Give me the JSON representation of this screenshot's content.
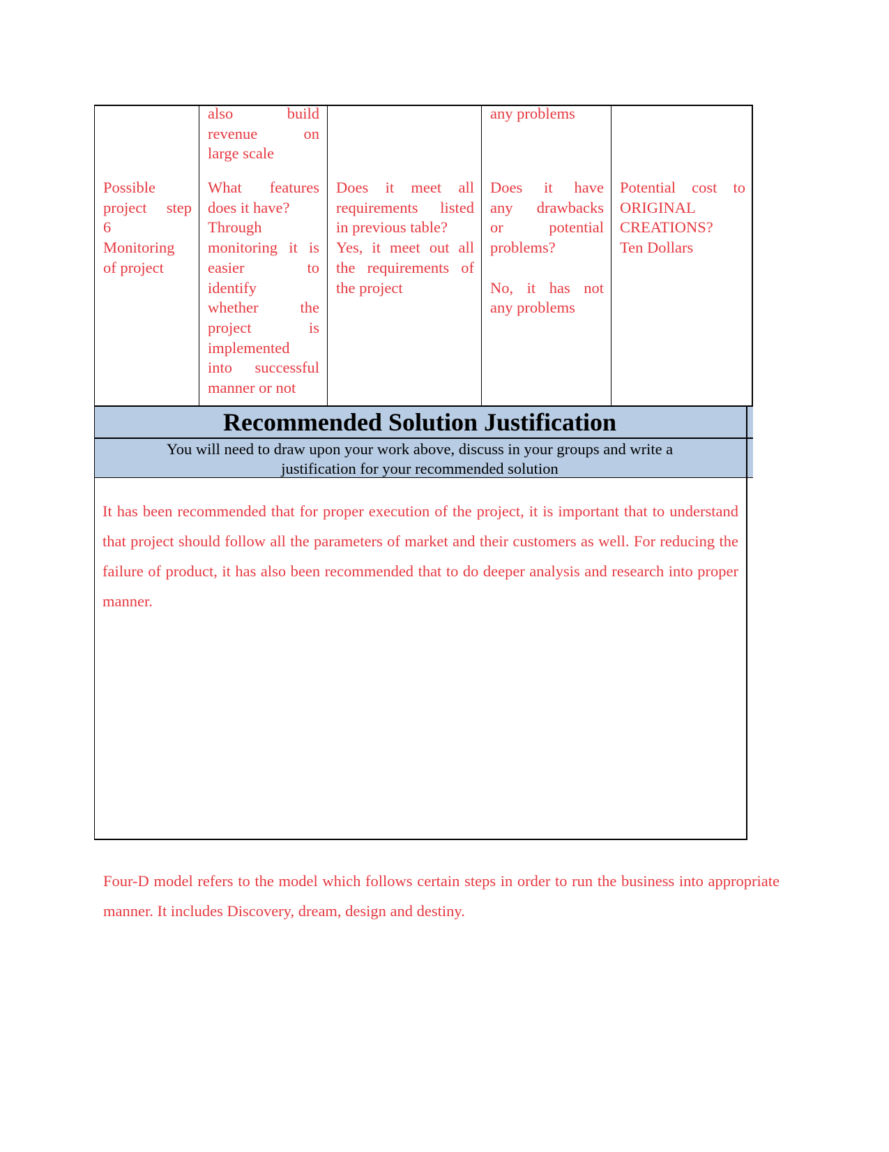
{
  "table": {
    "columns": [
      {
        "name": "project-step",
        "top_text": "",
        "lines": [
          "Possible",
          "project step",
          "6",
          "Monitoring",
          "of project"
        ]
      },
      {
        "name": "features",
        "top_lines": [
          "also build",
          "revenue on",
          "large scale"
        ],
        "lines": [
          "What features",
          "does it have?",
          "Through",
          "monitoring it is",
          "easier to",
          "identify",
          "whether the",
          "project is",
          "implemented",
          "into successful",
          "manner or not"
        ]
      },
      {
        "name": "requirements",
        "top_lines": [],
        "lines": [
          "Does it meet all",
          "requirements listed",
          "in previous table?",
          "Yes, it meet out all",
          "the requirements of",
          "the project"
        ]
      },
      {
        "name": "drawbacks",
        "top_lines": [
          "any problems"
        ],
        "lines": [
          "Does it have",
          "any drawbacks",
          "or potential",
          "problems?",
          "",
          "No, it has not",
          "any problems"
        ]
      },
      {
        "name": "cost",
        "top_lines": [],
        "lines": [
          "Potential cost to",
          "ORIGINAL",
          "CREATIONS?",
          "Ten Dollars"
        ]
      }
    ]
  },
  "section": {
    "title": "Recommended Solution Justification",
    "instruction": "You will need to draw upon your work above, discuss in your groups and write a justification for your recommended solution",
    "instruction_lines": [
      "You will need to draw upon your work above, discuss in your groups and write a",
      "justification for your recommended solution"
    ],
    "body": "It has been recommended that for proper execution of the project, it is important that to understand that project should follow all the parameters of market and their customers as well. For reducing the failure of product, it has also been recommended that to do deeper analysis and research into proper manner."
  },
  "footer": {
    "paragraph": "Four-D model refers to the model which follows certain steps in order to run the business into appropriate manner. It includes Discovery, dream, design and destiny."
  },
  "colors": {
    "answer_text": "#e5383f",
    "header_band": "#b8cce4",
    "border": "#000000"
  }
}
